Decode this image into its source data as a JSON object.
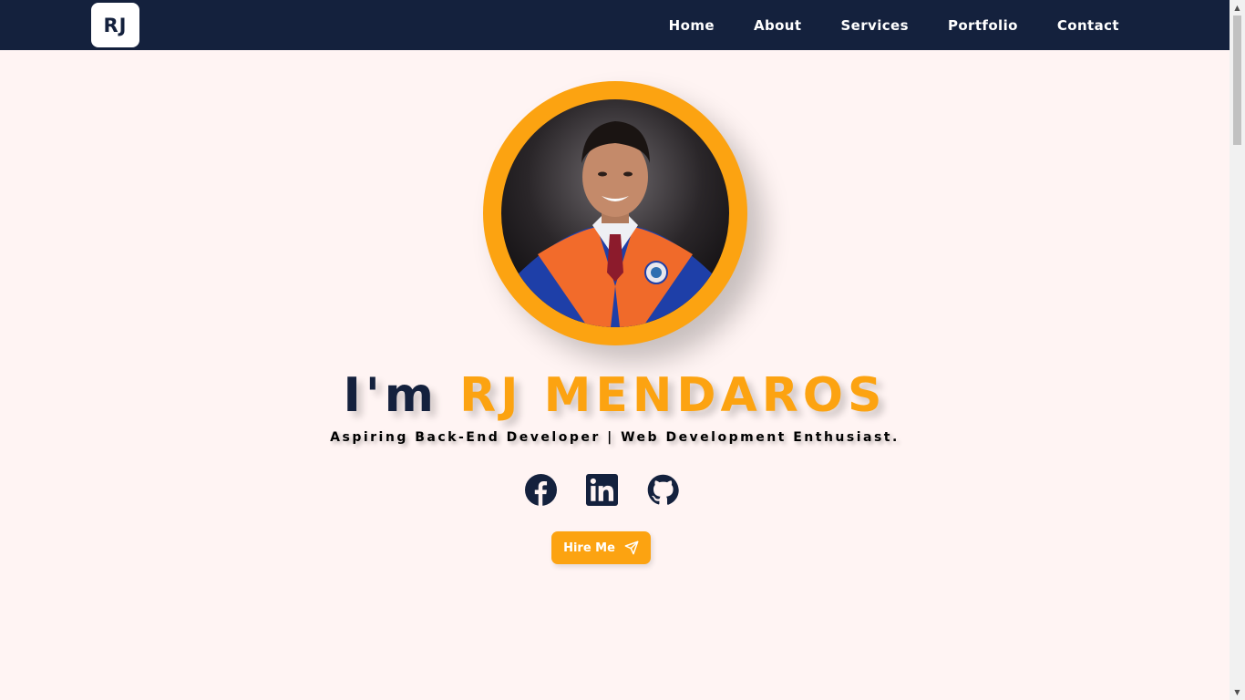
{
  "header": {
    "logo_text": "RJ",
    "nav": [
      {
        "label": "Home"
      },
      {
        "label": "About"
      },
      {
        "label": "Services"
      },
      {
        "label": "Portfolio"
      },
      {
        "label": "Contact"
      }
    ]
  },
  "hero": {
    "greeting": "I'm",
    "name": "RJ MENDAROS",
    "subtitle": "Aspiring Back-End Developer | Web Development Enthusiast.",
    "socials": [
      {
        "icon": "facebook-icon"
      },
      {
        "icon": "linkedin-icon"
      },
      {
        "icon": "github-icon"
      }
    ],
    "cta_label": "Hire Me",
    "cta_icon": "paper-plane-icon"
  },
  "colors": {
    "navy": "#14213d",
    "accent": "#fca311",
    "background": "#fff4f3"
  }
}
